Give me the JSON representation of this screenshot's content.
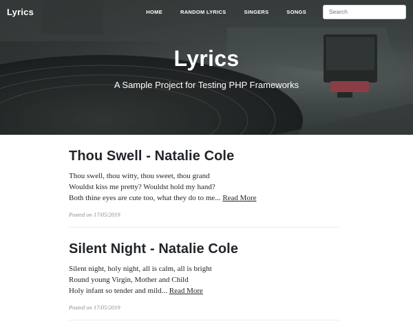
{
  "navbar": {
    "brand": "Lyrics",
    "links": [
      {
        "label": "HOME"
      },
      {
        "label": "RANDOM LYRICS"
      },
      {
        "label": "SINGERS"
      },
      {
        "label": "SONGS"
      }
    ],
    "search": {
      "placeholder": "Search",
      "value": ""
    }
  },
  "hero": {
    "title": "Lyrics",
    "subtitle": "A Sample Project for Testing PHP Frameworks"
  },
  "posts": [
    {
      "title": "Thou Swell - Natalie Cole",
      "lines": [
        "Thou swell, thou witty, thou sweet, thou grand",
        "Wouldst kiss me pretty? Wouldst hold my hand?",
        "Both thine eyes are cute too, what they do to me..."
      ],
      "read_more": "Read More",
      "posted": "Posted on 17/05/2019"
    },
    {
      "title": "Silent Night - Natalie Cole",
      "lines": [
        "Silent night, holy night, all is calm, all is bright",
        "Round young Virgin, Mother and Child",
        "Holy infant so tender and mild..."
      ],
      "read_more": "Read More",
      "posted": "Posted on 17/05/2019"
    }
  ]
}
